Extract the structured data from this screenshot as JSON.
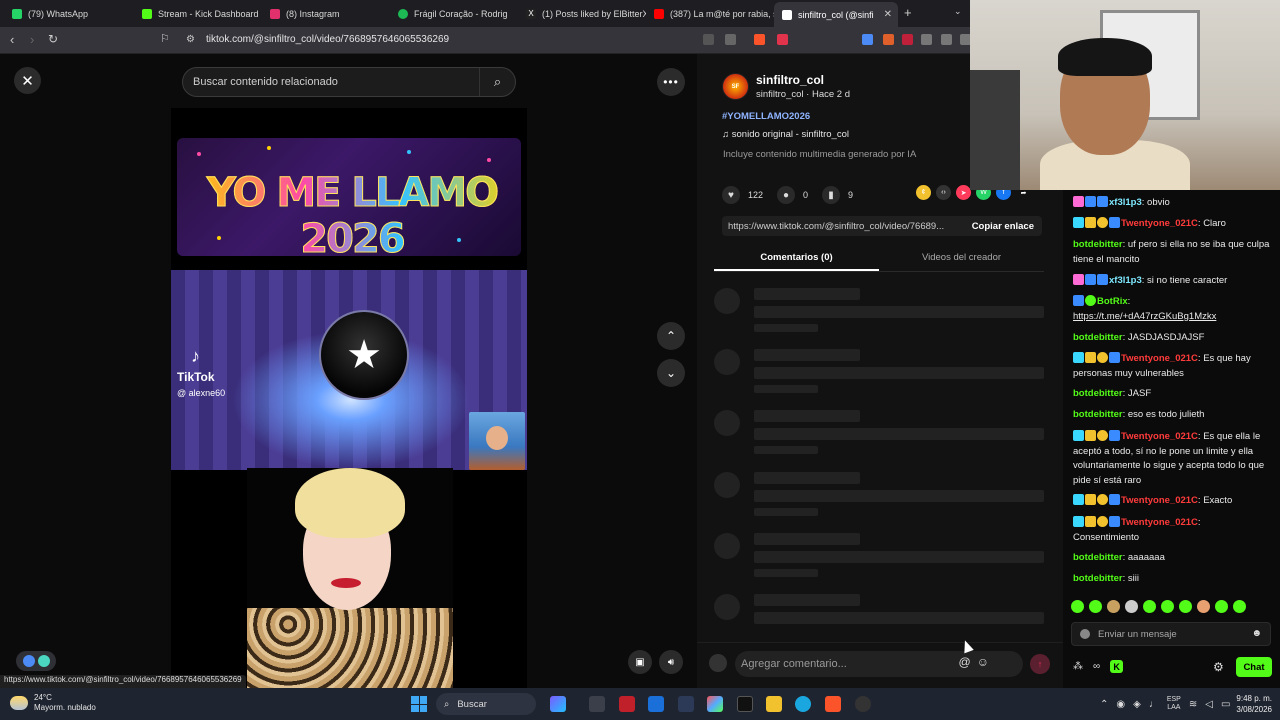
{
  "browser": {
    "tabs": [
      {
        "label": "(79) WhatsApp",
        "color": "#25d366"
      },
      {
        "label": "Stream - Kick Dashboard",
        "color": "#53fc18"
      },
      {
        "label": "(8) Instagram",
        "color": "#e1306c"
      },
      {
        "label": "Frágil Coração - Rodrig",
        "color": "#1db954"
      },
      {
        "label": "(1) Posts liked by ElBitterX",
        "color": "#ffffff"
      },
      {
        "label": "(387) La m@té por rabia, s",
        "color": "#ff0000"
      },
      {
        "label": "sinfiltro_col (@sinfi",
        "color": "#ffffff"
      }
    ],
    "url": "tiktok.com/@sinfiltro_col/video/7668957646065536269",
    "status_url": "https://www.tiktok.com/@sinfiltro_col/video/7668957646065536269"
  },
  "viewer": {
    "search_placeholder": "Buscar contenido relacionado",
    "banner_text": "YO ME LLAMO 2026",
    "tiktok_logo": "TikTok",
    "tiktok_user": "@ alexne60"
  },
  "details": {
    "author_name": "sinfiltro_col",
    "author_meta": "sinfiltro_col · Hace 2 d",
    "hashtag": "#YOMELLAMO2026",
    "sound": "sonido original - sinfiltro_col",
    "ai_note": "Incluye contenido multimedia generado por IA",
    "likes": "122",
    "comments": "0",
    "saves": "9",
    "link": "https://www.tiktok.com/@sinfiltro_col/video/76689...",
    "copy_label": "Copiar enlace",
    "tab_comments": "Comentarios (0)",
    "tab_creator": "Videos del creador",
    "comment_placeholder": "Agregar comentario..."
  },
  "chat": {
    "messages": [
      {
        "user": "xf3l1p3",
        "text": "obvio",
        "color": "cyan"
      },
      {
        "user": "Twentyone_021C",
        "text": "Claro",
        "color": "red"
      },
      {
        "user": "botdebitter",
        "text": "uf pero si ella no se iba que culpa tiene el mancito",
        "color": "green"
      },
      {
        "user": "xf3l1p3",
        "text": "si no tiene caracter",
        "color": "cyan"
      },
      {
        "user": "BotRix",
        "text": "https://t.me/+dA47rzGKuBg1Mzkx",
        "color": "green"
      },
      {
        "user": "botdebitter",
        "text": "JASDJASDJAJSF",
        "color": "green"
      },
      {
        "user": "Twentyone_021C",
        "text": "Es que hay personas muy vulnerables",
        "color": "red"
      },
      {
        "user": "botdebitter",
        "text": "JASF",
        "color": "green"
      },
      {
        "user": "botdebitter",
        "text": "eso es todo julieth",
        "color": "green"
      },
      {
        "user": "Twentyone_021C",
        "text": "Es que ella le aceptó a todo, sí no le pone un limite y ella voluntariamente lo sigue y acepta todo lo que pide sí está raro",
        "color": "red"
      },
      {
        "user": "Twentyone_021C",
        "text": "Exacto",
        "color": "red"
      },
      {
        "user": "Twentyone_021C",
        "text": "Consentimiento",
        "color": "red"
      },
      {
        "user": "botdebitter",
        "text": "aaaaaaa",
        "color": "green"
      },
      {
        "user": "botdebitter",
        "text": "siii",
        "color": "green"
      }
    ],
    "input_placeholder": "Enviar un mensaje",
    "chat_button": "Chat"
  },
  "taskbar": {
    "temperature": "24°C",
    "weather": "Mayorm. nublado",
    "search": "Buscar",
    "lang1": "ESP",
    "lang2": "LAA",
    "time": "9:48 p. m.",
    "date": "3/08/2026"
  }
}
